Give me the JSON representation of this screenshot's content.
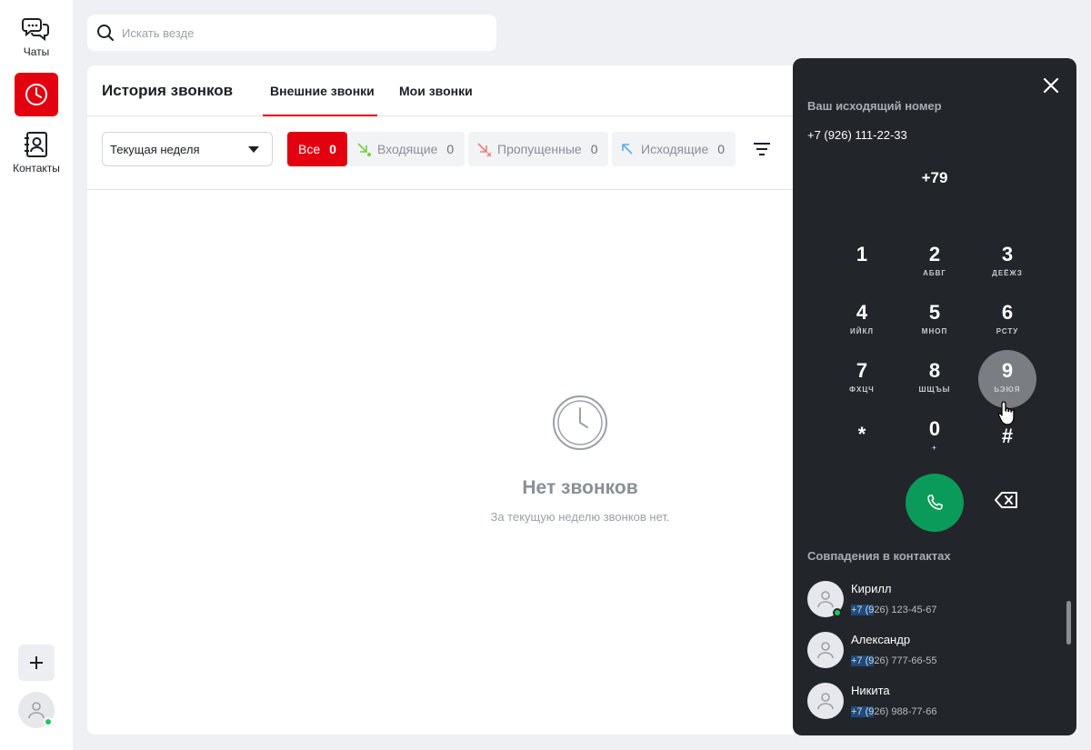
{
  "rail": {
    "chats_label": "Чаты",
    "contacts_label": "Контакты",
    "active_color": "#e3000f"
  },
  "search": {
    "placeholder": "Искать везде"
  },
  "calls": {
    "title": "История звонков",
    "tabs": [
      {
        "label": "Внешние звонки",
        "active": true
      },
      {
        "label": "Мои звонки",
        "active": false
      }
    ],
    "period": "Текущая неделя",
    "filters": [
      {
        "label": "Все",
        "count": "0",
        "active": true
      },
      {
        "label": "Входящие",
        "count": "0",
        "icon": "incoming-arrow-icon"
      },
      {
        "label": "Пропущенные",
        "count": "0",
        "icon": "missed-arrow-icon"
      },
      {
        "label": "Исходящие",
        "count": "0",
        "icon": "outgoing-arrow-icon"
      }
    ],
    "empty": {
      "title": "Нет звонков",
      "subtitle": "За текущую неделю звонков нет."
    }
  },
  "dialer": {
    "outgoing_label": "Ваш исходящий номер",
    "outgoing_number": "+7 (926) 111-22-33",
    "display": "+79",
    "keys": [
      {
        "digit": "1",
        "letters": ""
      },
      {
        "digit": "2",
        "letters": "АБВГ"
      },
      {
        "digit": "3",
        "letters": "ДЕЁЖЗ"
      },
      {
        "digit": "4",
        "letters": "ИЙКЛ"
      },
      {
        "digit": "5",
        "letters": "МНОП"
      },
      {
        "digit": "6",
        "letters": "РСТУ"
      },
      {
        "digit": "7",
        "letters": "ФХЦЧ"
      },
      {
        "digit": "8",
        "letters": "ШЩЪЫ"
      },
      {
        "digit": "9",
        "letters": "ЬЭЮЯ"
      },
      {
        "digit": "*",
        "letters": ""
      },
      {
        "digit": "0",
        "letters": "+"
      },
      {
        "digit": "#",
        "letters": ""
      }
    ],
    "pressed_key": "9",
    "call_color": "#0a9b5a",
    "matches_title": "Совпадения в контактах",
    "contacts": [
      {
        "name": "Кирилл",
        "phone_match": "+7 (9",
        "phone_rest": "26) 123-45-67",
        "online": true
      },
      {
        "name": "Александр",
        "phone_match": "+7 (9",
        "phone_rest": "26) 777-66-55",
        "online": false
      },
      {
        "name": "Никита",
        "phone_match": "+7 (9",
        "phone_rest": "26) 988-77-66",
        "online": false
      }
    ]
  }
}
